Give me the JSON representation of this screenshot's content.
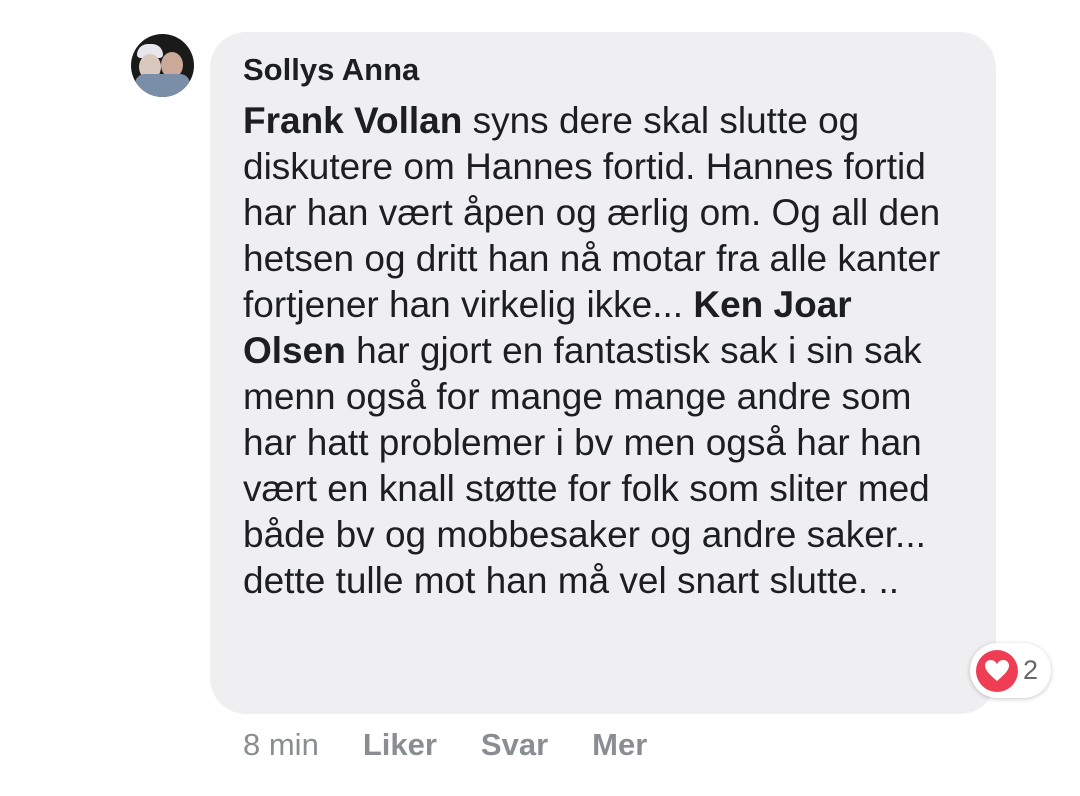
{
  "comment": {
    "author": "Sollys Anna",
    "avatar_icon": "profile-photo",
    "text_parts": [
      {
        "mention": "Frank Vollan"
      },
      {
        "text": " syns dere skal slutte og diskutere om Hannes fortid. Hannes fortid har han vært åpen og ærlig om. Og all den hetsen og dritt han nå motar fra alle kanter fortjener han virkelig ikke... "
      },
      {
        "mention": "Ken Joar Olsen"
      },
      {
        "text": " har gjort en fantastisk sak i sin sak menn også for mange mange andre som har hatt problemer i bv men også har han vært en knall støtte for folk som sliter med både bv og mobbesaker og andre saker... dette tulle mot han må vel snart slutte. .."
      }
    ],
    "reaction": {
      "icon": "heart-icon",
      "count": "2",
      "color": "#ef3e54"
    },
    "footer": {
      "time": "8 min",
      "like_label": "Liker",
      "reply_label": "Svar",
      "more_label": "Mer"
    }
  },
  "colors": {
    "bubble_bg": "#efeff2",
    "text": "#1c1e21",
    "muted": "#8a8d91"
  }
}
